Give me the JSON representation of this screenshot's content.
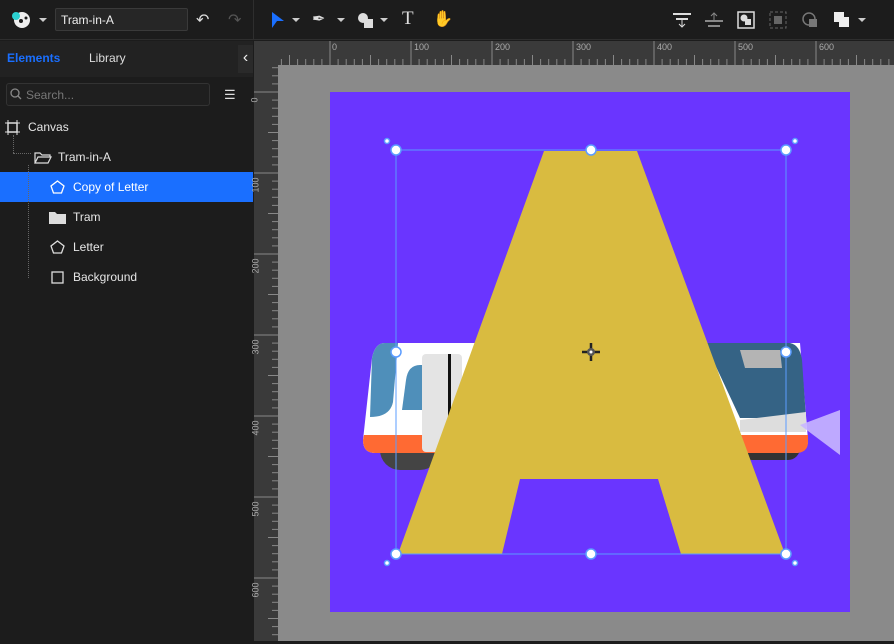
{
  "toolbar": {
    "document_name": "Tram-in-A",
    "icons": [
      "app-logo-icon",
      "undo-icon",
      "redo-icon",
      "select-arrow-icon",
      "pen-icon",
      "shapes-icon",
      "text-icon",
      "hand-icon",
      "align-top-icon",
      "align-middle-icon",
      "group-icon",
      "ungroup-icon",
      "mask-icon",
      "boolean-icon"
    ],
    "accent": "#1a6fff"
  },
  "panel": {
    "tabs": [
      {
        "label": "Elements",
        "active": true
      },
      {
        "label": "Library",
        "active": false
      }
    ],
    "search_placeholder": "Search...",
    "layers": [
      {
        "label": "Canvas",
        "icon": "artboard-icon",
        "selected": false
      },
      {
        "label": "Tram-in-A",
        "icon": "folder-open-icon",
        "selected": false
      },
      {
        "label": "Copy of Letter",
        "icon": "pentagon-icon",
        "selected": true
      },
      {
        "label": "Tram",
        "icon": "folder-icon",
        "selected": false
      },
      {
        "label": "Letter",
        "icon": "pentagon-icon",
        "selected": false
      },
      {
        "label": "Background",
        "icon": "square-icon",
        "selected": false
      }
    ]
  },
  "rulers": {
    "horizontal": [
      "0",
      "100",
      "200",
      "300",
      "400",
      "500",
      "600"
    ],
    "vertical": [
      "0",
      "100",
      "200",
      "300",
      "400",
      "500",
      "600"
    ]
  },
  "canvas": {
    "background_color": "#6a35ff",
    "letter_color": "#d9bb40",
    "selection_color": "#5b9cff"
  }
}
